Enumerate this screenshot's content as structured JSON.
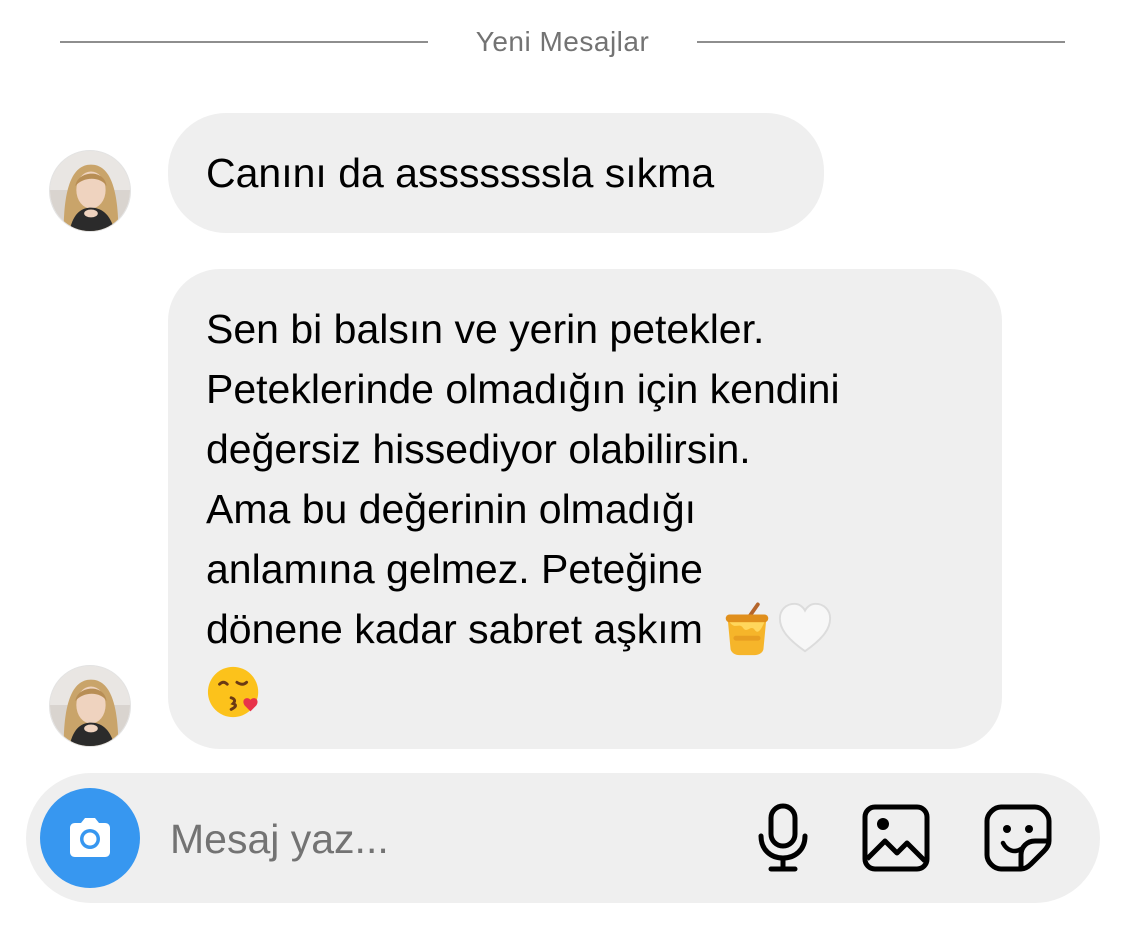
{
  "divider": {
    "label": "Yeni Mesajlar"
  },
  "messages": [
    {
      "text": "Canını da asssssssla sıkma"
    },
    {
      "text": "Sen bi balsın ve yerin petekler.\nPeteklerinde olmadığın için kendini\ndeğersiz hissediyor olabilirsin.\nAma bu değerinin olmadığı\nanlamına gelmez. Peteğine\ndönene kadar sabret aşkım",
      "emojis": [
        "honey-pot-emoji",
        "white-heart-emoji",
        "face-blowing-kiss-emoji"
      ]
    }
  ],
  "composer": {
    "placeholder": "Mesaj yaz...",
    "icons": [
      "camera-icon",
      "microphone-icon",
      "image-icon",
      "sticker-icon"
    ]
  },
  "colors": {
    "accent": "#3797f0",
    "bubble": "#efefef",
    "divider": "#8e8e8e"
  }
}
